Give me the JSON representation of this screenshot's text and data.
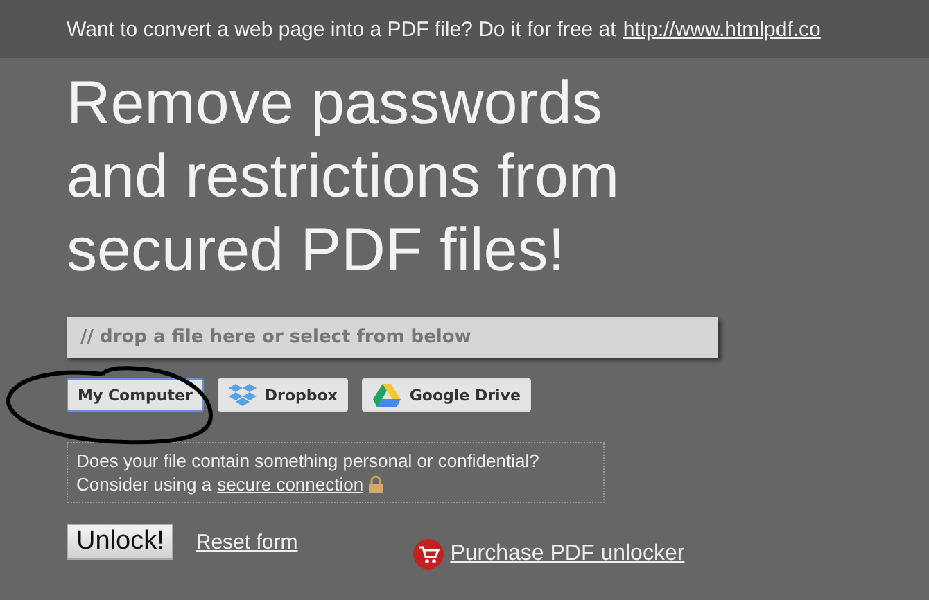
{
  "top_bar": {
    "text": "Want to convert a web page into a PDF file? Do it for free at",
    "link": "http://www.htmlpdf.co"
  },
  "heading": "Remove passwords and restrictions from secured PDF files!",
  "drop_field": {
    "placeholder": "// drop a file here or select from below"
  },
  "sources": [
    {
      "label": "My Computer",
      "kind": "computer",
      "selected": true
    },
    {
      "label": "Dropbox",
      "kind": "dropbox",
      "selected": false
    },
    {
      "label": "Google Drive",
      "kind": "drive",
      "selected": false
    }
  ],
  "notice": {
    "line_1": "Does your file contain something personal or confidential?",
    "line_2": "Consider using a",
    "link": "secure connection"
  },
  "actions": {
    "unlock": "Unlock!",
    "reset": "Reset form",
    "purchase": "Purchase PDF unlocker"
  }
}
